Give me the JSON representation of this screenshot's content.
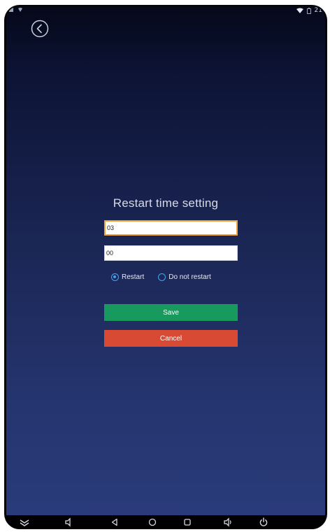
{
  "status_bar": {
    "time": "21"
  },
  "dialog": {
    "title": "Restart time setting",
    "hour_value": "03",
    "minute_value": "00",
    "radio_options": [
      {
        "label": "Restart",
        "checked": true
      },
      {
        "label": "Do not restart",
        "checked": false
      }
    ],
    "save_label": "Save",
    "cancel_label": "Cancel"
  },
  "colors": {
    "save": "#189a5e",
    "cancel": "#d94a35",
    "focus_border": "#f2a43a",
    "radio_accent": "#3ea6ef"
  },
  "nav_icons": [
    "collapse-icon",
    "volume-down-icon",
    "back-triangle-icon",
    "home-circle-icon",
    "recents-square-icon",
    "volume-up-icon",
    "power-icon"
  ]
}
